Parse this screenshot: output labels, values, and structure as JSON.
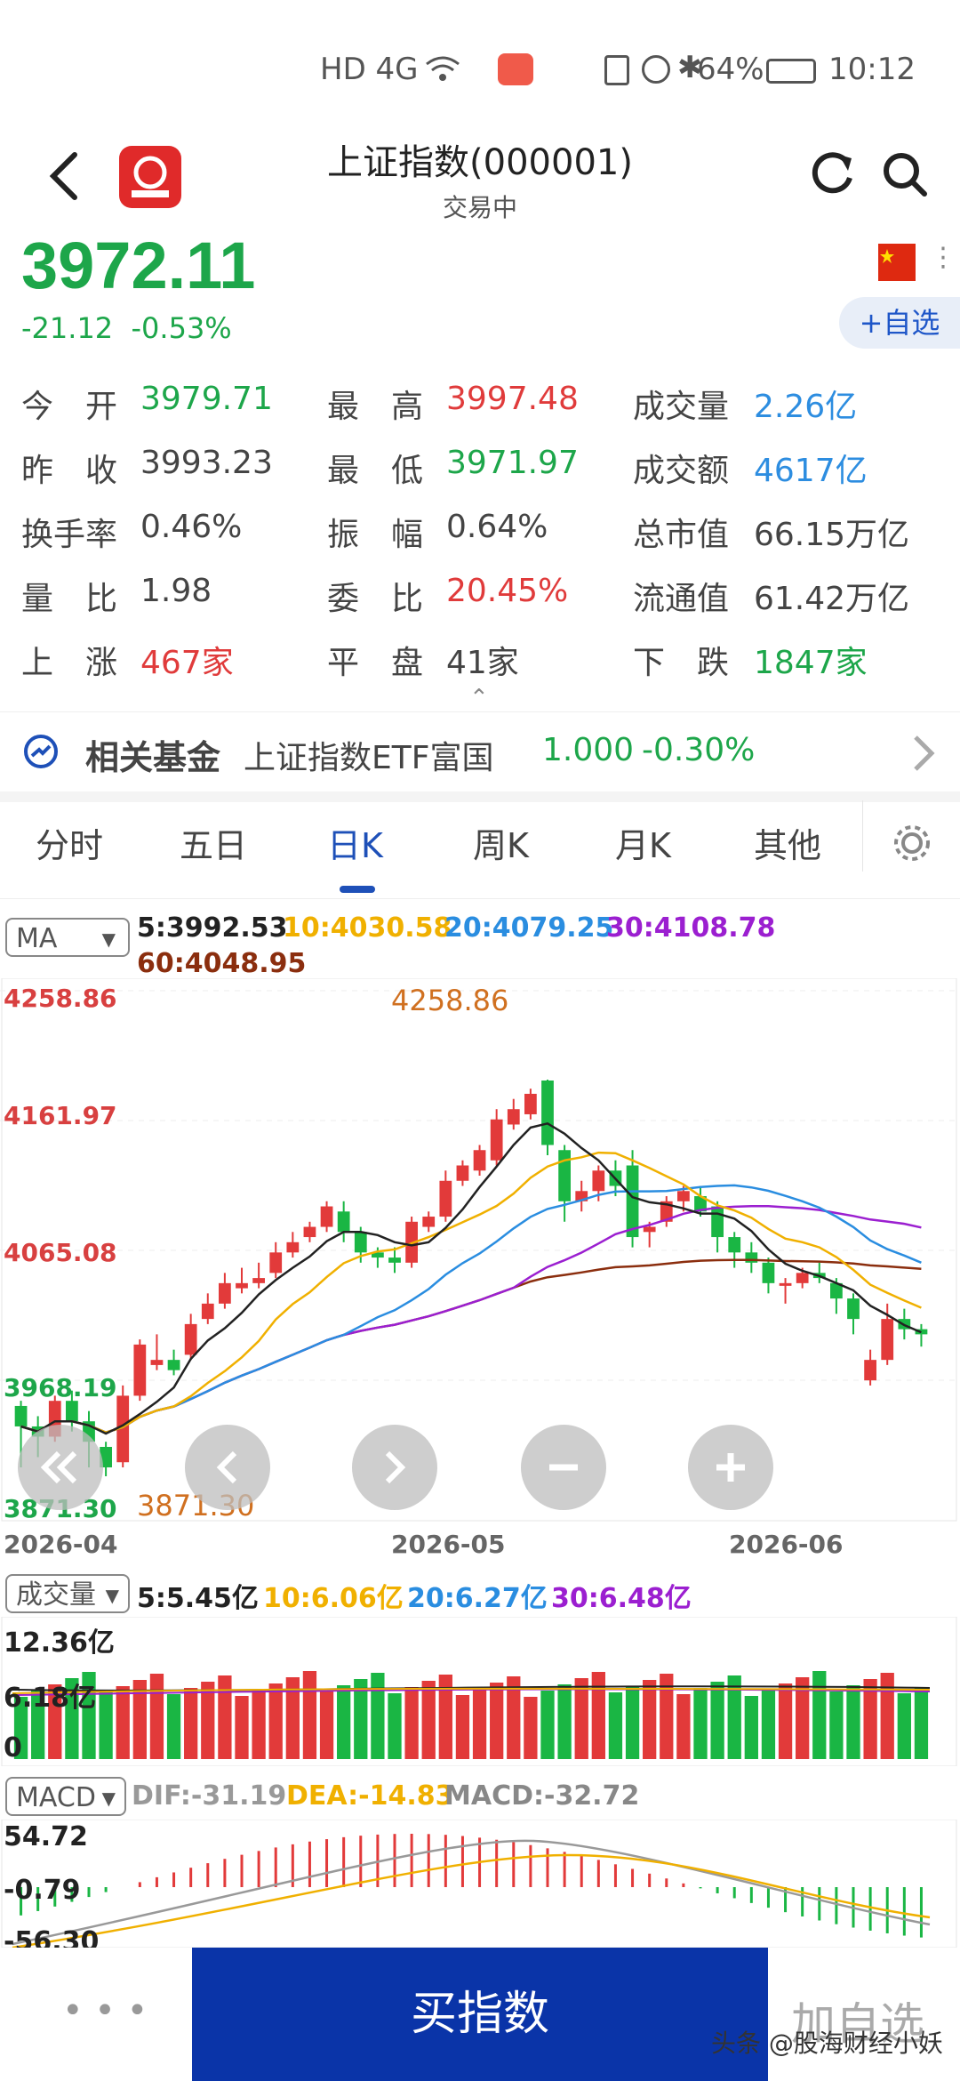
{
  "status_bar": {
    "signal": "HD 4G",
    "battery": "64%",
    "time": "10:12"
  },
  "header": {
    "title": "上证指数(000001)",
    "subtitle": "交易中"
  },
  "quote": {
    "price": "3972.11",
    "change": "-21.12",
    "change_pct": "-0.53%",
    "add_watch": "+自选"
  },
  "stats": [
    [
      {
        "label": "今　开",
        "value": "3979.71",
        "color": "green"
      },
      {
        "label": "最　高",
        "value": "3997.48",
        "color": "red"
      },
      {
        "label": "成交量",
        "value": "2.26亿",
        "color": "blue"
      }
    ],
    [
      {
        "label": "昨　收",
        "value": "3993.23",
        "color": "dark"
      },
      {
        "label": "最　低",
        "value": "3971.97",
        "color": "green"
      },
      {
        "label": "成交额",
        "value": "4617亿",
        "color": "blue"
      }
    ],
    [
      {
        "label": "换手率",
        "value": "0.46%",
        "color": "dark"
      },
      {
        "label": "振　幅",
        "value": "0.64%",
        "color": "dark"
      },
      {
        "label": "总市值",
        "value": "66.15万亿",
        "color": "dark"
      }
    ],
    [
      {
        "label": "量　比",
        "value": "1.98",
        "color": "dark"
      },
      {
        "label": "委　比",
        "value": "20.45%",
        "color": "red"
      },
      {
        "label": "流通值",
        "value": "61.42万亿",
        "color": "dark"
      }
    ],
    [
      {
        "label": "上　涨",
        "value": "467家",
        "color": "red"
      },
      {
        "label": "平　盘",
        "value": "41家",
        "color": "dark"
      },
      {
        "label": "下　跌",
        "value": "1847家",
        "color": "green"
      }
    ]
  ],
  "fund": {
    "title": "相关基金",
    "name": "上证指数ETF富国",
    "price": "1.000",
    "change": "-0.30%"
  },
  "tabs": [
    "分时",
    "五日",
    "日K",
    "周K",
    "月K",
    "其他"
  ],
  "ma": {
    "selector": "MA",
    "ma5": "5:3992.53",
    "ma10": "10:4030.58",
    "ma20": "20:4079.25",
    "ma30": "30:4108.78",
    "ma60": "60:4048.95",
    "colors": {
      "ma5": "#222222",
      "ma10": "#f0b000",
      "ma20": "#2a8de0",
      "ma30": "#9b1fd0",
      "ma60": "#8b2e0e"
    }
  },
  "kline_axis": {
    "y_labels": [
      "4258.86",
      "4161.97",
      "4065.08",
      "3968.19",
      "3871.30"
    ],
    "high_annot": "4258.86",
    "low_annot": "3871.30",
    "dates": [
      "2026-04",
      "2026-05",
      "2026-06"
    ]
  },
  "volume": {
    "selector": "成交量",
    "ma5": "5:5.45亿",
    "ma10": "10:6.06亿",
    "ma20": "20:6.27亿",
    "ma30": "30:6.48亿",
    "y_labels": [
      "12.36亿",
      "6.18亿",
      "0"
    ]
  },
  "macd": {
    "selector": "MACD",
    "dif": "DIF:-31.19",
    "dea": "DEA:-14.83",
    "macd": "MACD:-32.72",
    "y_labels": [
      "54.72",
      "-0.79",
      "-56.30"
    ]
  },
  "chart_data": {
    "type": "candlestick",
    "ylim": [
      3871.3,
      4258.86
    ],
    "candles": [
      [
        3940,
        3920,
        3945,
        3880
      ],
      [
        3920,
        3910,
        3930,
        3890
      ],
      [
        3910,
        3945,
        3950,
        3905
      ],
      [
        3945,
        3925,
        3955,
        3915
      ],
      [
        3925,
        3905,
        3935,
        3880
      ],
      [
        3900,
        3880,
        3905,
        3871.3
      ],
      [
        3885,
        3950,
        3960,
        3880
      ],
      [
        3950,
        4000,
        4005,
        3945
      ],
      [
        3980,
        3985,
        4010,
        3975
      ],
      [
        3985,
        3975,
        3995,
        3970
      ],
      [
        3990,
        4020,
        4030,
        3985
      ],
      [
        4025,
        4040,
        4050,
        4020
      ],
      [
        4040,
        4060,
        4070,
        4035
      ],
      [
        4055,
        4060,
        4075,
        4050
      ],
      [
        4060,
        4065,
        4080,
        4055
      ],
      [
        4070,
        4090,
        4100,
        4065
      ],
      [
        4090,
        4100,
        4110,
        4085
      ],
      [
        4105,
        4115,
        4120,
        4100
      ],
      [
        4115,
        4135,
        4140,
        4110
      ],
      [
        4130,
        4110,
        4140,
        4100
      ],
      [
        4110,
        4090,
        4115,
        4080
      ],
      [
        4090,
        4085,
        4095,
        4075
      ],
      [
        4085,
        4080,
        4095,
        4070
      ],
      [
        4080,
        4120,
        4125,
        4075
      ],
      [
        4115,
        4125,
        4130,
        4110
      ],
      [
        4125,
        4160,
        4170,
        4120
      ],
      [
        4160,
        4175,
        4180,
        4155
      ],
      [
        4170,
        4190,
        4195,
        4165
      ],
      [
        4180,
        4220,
        4230,
        4175
      ],
      [
        4215,
        4230,
        4240,
        4210
      ],
      [
        4225,
        4245,
        4250,
        4220
      ],
      [
        4258,
        4195,
        4258.86,
        4185
      ],
      [
        4190,
        4140,
        4195,
        4120
      ],
      [
        4140,
        4150,
        4160,
        4130
      ],
      [
        4150,
        4170,
        4175,
        4140
      ],
      [
        4170,
        4155,
        4180,
        4145
      ],
      [
        4175,
        4105,
        4190,
        4095
      ],
      [
        4110,
        4115,
        4120,
        4095
      ],
      [
        4120,
        4140,
        4145,
        4115
      ],
      [
        4140,
        4150,
        4155,
        4130
      ],
      [
        4145,
        4130,
        4155,
        4125
      ],
      [
        4135,
        4105,
        4140,
        4090
      ],
      [
        4105,
        4090,
        4110,
        4075
      ],
      [
        4090,
        4080,
        4100,
        4070
      ],
      [
        4080,
        4060,
        4085,
        4050
      ],
      [
        4060,
        4060,
        4065,
        4040
      ],
      [
        4060,
        4070,
        4075,
        4055
      ],
      [
        4070,
        4065,
        4080,
        4060
      ],
      [
        4060,
        4045,
        4065,
        4030
      ],
      [
        4045,
        4025,
        4050,
        4010
      ],
      [
        3965,
        3985,
        3995,
        3960
      ],
      [
        3985,
        4025,
        4040,
        3980
      ],
      [
        4025,
        4015,
        4035,
        4005
      ],
      [
        4015,
        4010,
        4020,
        3998
      ]
    ]
  },
  "bottom": {
    "more": "• • •",
    "buy": "买指数",
    "add": "加自选",
    "watermark": "头条 @股海财经小妖"
  }
}
